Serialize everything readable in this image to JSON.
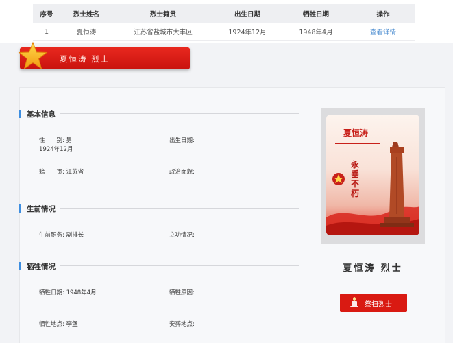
{
  "table": {
    "headers": [
      "序号",
      "烈士姓名",
      "烈士籍贯",
      "出生日期",
      "牺牲日期",
      "操作"
    ],
    "rows": [
      [
        "1",
        "夏恒涛",
        "江苏省盐城市大丰区",
        "1924年12月",
        "1948年4月",
        "查看详情"
      ]
    ]
  },
  "banner": {
    "title": "夏恒涛 烈士"
  },
  "sections": {
    "basic": {
      "title": "基本信息",
      "gender_label": "性　　别:",
      "gender_value": "男",
      "birth_value": "1924年12月",
      "birth_label": "出生日期:",
      "native_label": "籍　　贯:",
      "native_value": "江苏省",
      "politics_label": "政治面貌:"
    },
    "life": {
      "title": "生前情况",
      "post_label": "生前职务:",
      "post_value": "副排长",
      "merit_label": "立功情况:"
    },
    "death": {
      "title": "牺牲情况",
      "date_label": "牺牲日期:",
      "date_value": "1948年4月",
      "reason_label": "牺牲原因:",
      "place_label": "牺牲地点:",
      "place_value": "李堡",
      "burial_label": "安葬地点:"
    }
  },
  "card": {
    "name": "夏恒涛",
    "motto": "永垂不朽"
  },
  "hero_name": "夏恒涛  烈士",
  "sweep_button": "祭扫烈士",
  "colors": {
    "accent_red": "#d91a12",
    "link_blue": "#4f8fd1",
    "section_bar": "#3e8ee0"
  },
  "icons": [
    "star-icon",
    "candle-icon",
    "monument-image"
  ]
}
